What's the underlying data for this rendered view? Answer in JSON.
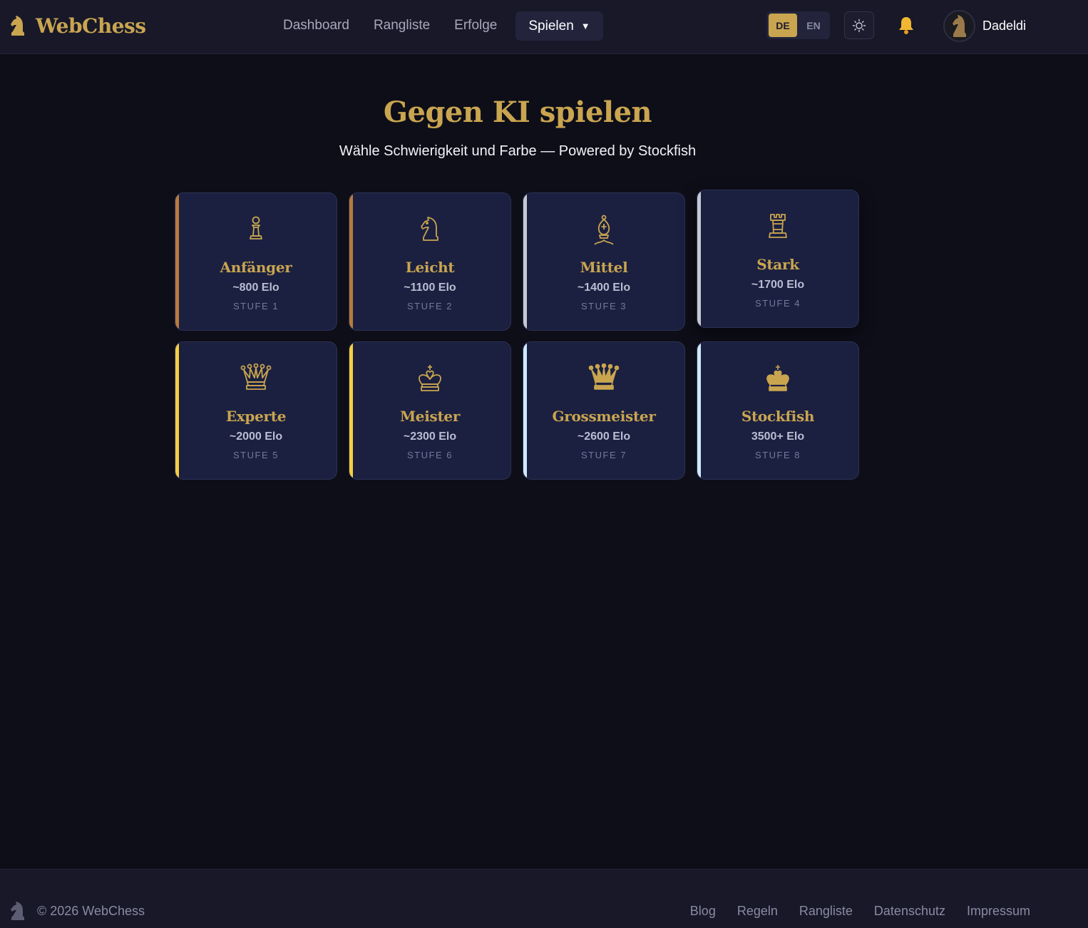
{
  "header": {
    "brand": "WebChess",
    "nav": [
      "Dashboard",
      "Rangliste",
      "Erfolge"
    ],
    "play_label": "Spielen",
    "play_caret": "▼",
    "lang": {
      "de": "DE",
      "en": "EN",
      "active": "DE"
    },
    "username": "Dadeldi"
  },
  "main": {
    "title": "Gegen KI spielen",
    "subtitle": "Wähle Schwierigkeit und Farbe — Powered by Stockfish",
    "levels": [
      {
        "name": "Anfänger",
        "elo": "~800 Elo",
        "level": "STUFE 1",
        "accent": "#b87b3c",
        "icon": "pawn-icon"
      },
      {
        "name": "Leicht",
        "elo": "~1100 Elo",
        "level": "STUFE 2",
        "accent": "#b87b3c",
        "icon": "knight-icon"
      },
      {
        "name": "Mittel",
        "elo": "~1400 Elo",
        "level": "STUFE 3",
        "accent": "#c7c9d1",
        "icon": "bishop-icon"
      },
      {
        "name": "Stark",
        "elo": "~1700 Elo",
        "level": "STUFE 4",
        "accent": "#c7c9d1",
        "icon": "rook-icon"
      },
      {
        "name": "Experte",
        "elo": "~2000 Elo",
        "level": "STUFE 5",
        "accent": "#f5cf3f",
        "icon": "queen-icon"
      },
      {
        "name": "Meister",
        "elo": "~2300 Elo",
        "level": "STUFE 6",
        "accent": "#f5cf3f",
        "icon": "king-icon"
      },
      {
        "name": "Grossmeister",
        "elo": "~2600 Elo",
        "level": "STUFE 7",
        "accent": "#cfe9ff",
        "icon": "queen-filled-icon"
      },
      {
        "name": "Stockfish",
        "elo": "3500+ Elo",
        "level": "STUFE 8",
        "accent": "#cfe9ff",
        "icon": "king-filled-icon"
      }
    ]
  },
  "footer": {
    "copyright": "© 2026 WebChess",
    "links": [
      "Blog",
      "Regeln",
      "Rangliste",
      "Datenschutz",
      "Impressum"
    ]
  },
  "colors": {
    "gold": "#c9a550",
    "background": "#0e0e19",
    "card": "#1b2040",
    "header": "#181829"
  }
}
